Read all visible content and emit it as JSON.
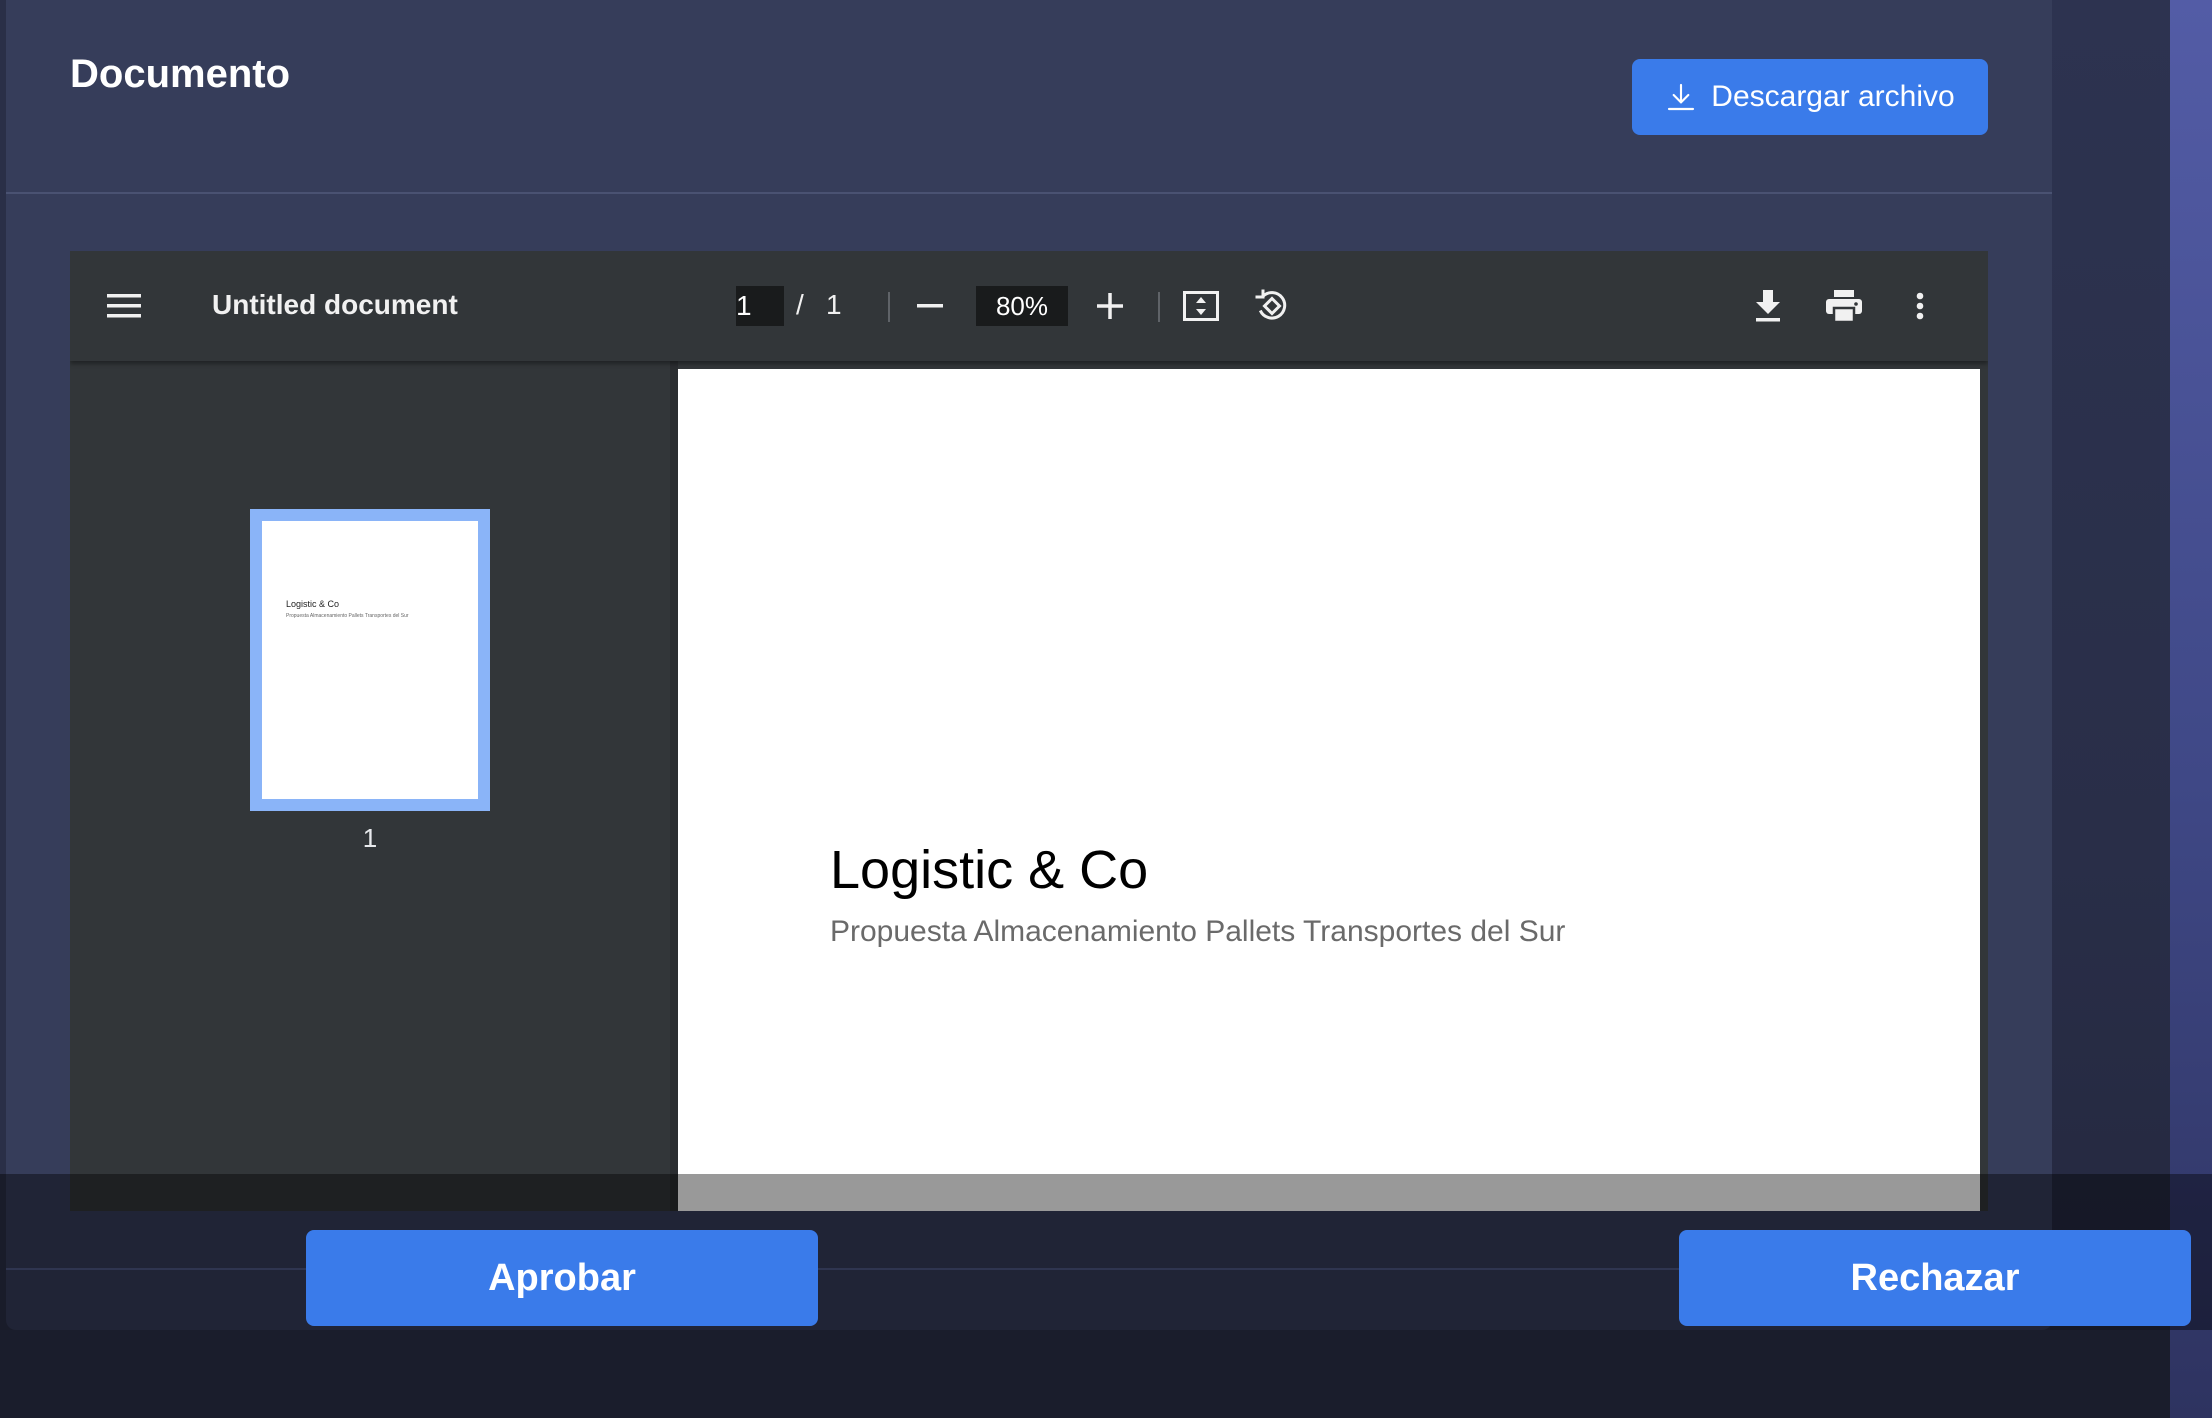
{
  "panel": {
    "title": "Documento"
  },
  "download_button": {
    "label": "Descargar archivo",
    "icon": "download-icon"
  },
  "viewer": {
    "toolbar": {
      "menu_icon": "menu-icon",
      "document_title": "Untitled document",
      "current_page": "1",
      "page_separator": "/",
      "total_pages": "1",
      "zoom_out_icon": "minus-icon",
      "zoom_level": "80%",
      "zoom_in_icon": "plus-icon",
      "fit_icon": "fit-to-page-icon",
      "rotate_icon": "rotate-icon",
      "download_icon": "download-icon",
      "print_icon": "print-icon",
      "more_icon": "more-vert-icon"
    },
    "thumbnail": {
      "title": "Logistic & Co",
      "subtitle": "Propuesta Almacenamiento Pallets Transportes del Sur",
      "page_number": "1"
    },
    "page": {
      "heading": "Logistic & Co",
      "subheading": "Propuesta Almacenamiento Pallets Transportes del Sur"
    }
  },
  "actions": {
    "approve": "Aprobar",
    "reject": "Rechazar"
  },
  "colors": {
    "accent": "#3a7bea",
    "panel": "#363d5a",
    "viewer_toolbar": "#323639",
    "thumbnail_highlight": "#8ab4f8"
  }
}
